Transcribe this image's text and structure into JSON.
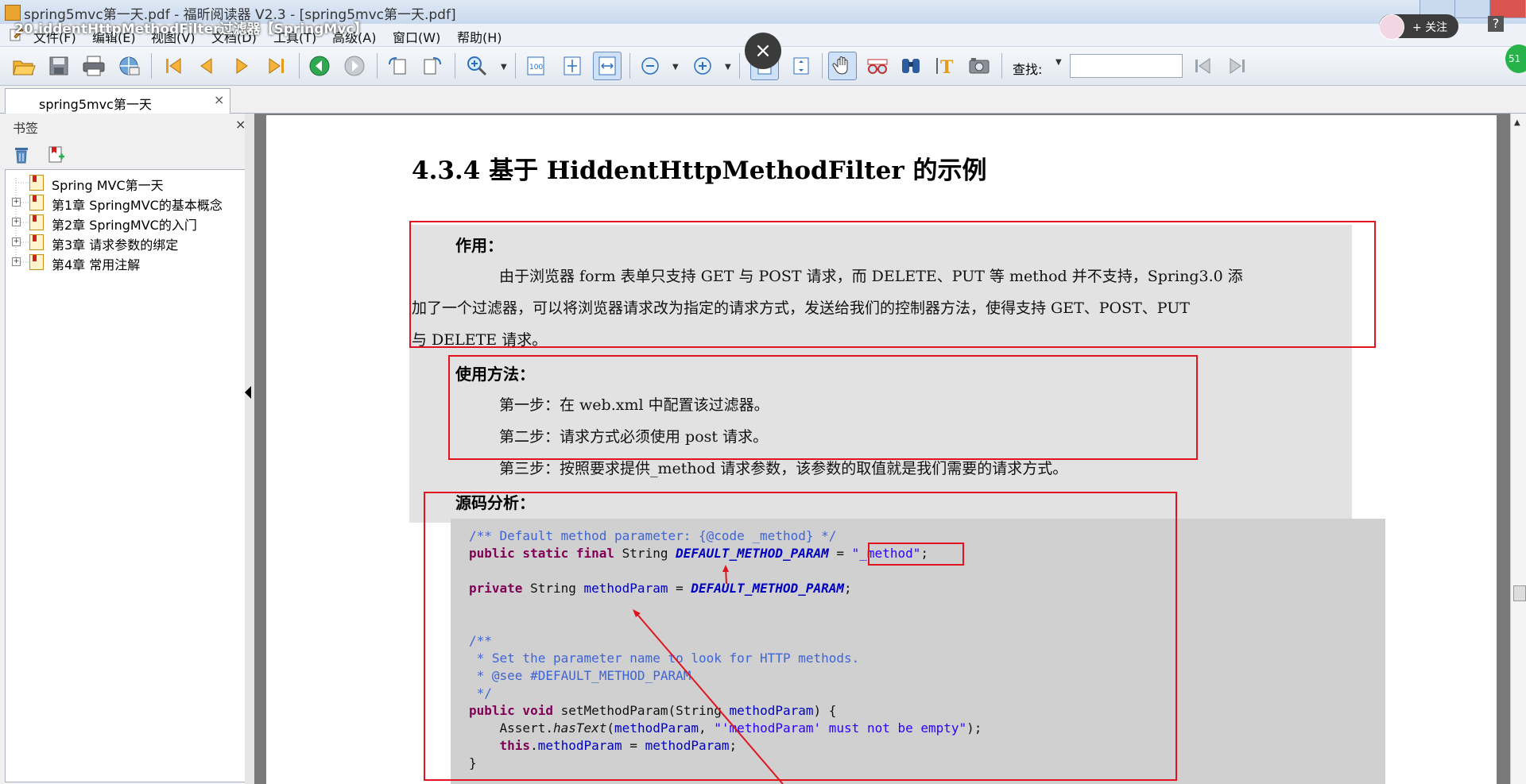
{
  "window": {
    "title": "spring5mvc第一天.pdf - 福昕阅读器 V2.3 - [spring5mvc第一天.pdf]",
    "video_title": "20.iddentHttpMethodFilter过滤器【SpringMvc】"
  },
  "menu": [
    "文件(F)",
    "编辑(E)",
    "视图(V)",
    "文档(D)",
    "工具(T)",
    "高级(A)",
    "窗口(W)",
    "帮助(H)"
  ],
  "toolbar": {
    "find_label": "查找:",
    "find_value": ""
  },
  "overlay": {
    "close_glyph": "×",
    "follow_label": "+ 关注",
    "help_glyph": "?",
    "badge": "51"
  },
  "tab": {
    "label": "spring5mvc第一天",
    "close": "×"
  },
  "bookmarks": {
    "header": "书签",
    "close": "×",
    "items": [
      {
        "label": "Spring MVC第一天",
        "expandable": false
      },
      {
        "label": "第1章 SpringMVC的基本概念",
        "expandable": true
      },
      {
        "label": "第2章 SpringMVC的入门",
        "expandable": true
      },
      {
        "label": "第3章 请求参数的绑定",
        "expandable": true
      },
      {
        "label": "第4章 常用注解",
        "expandable": true
      }
    ]
  },
  "document": {
    "heading": "4.3.4  基于 HiddentHttpMethodFilter 的示例",
    "purpose": {
      "title": "作用：",
      "lines": [
        "由于浏览器 form 表单只支持 GET 与 POST 请求，而 DELETE、PUT 等 method 并不支持，Spring3.0 添",
        "加了一个过滤器，可以将浏览器请求改为指定的请求方式，发送给我们的控制器方法，使得支持 GET、POST、PUT",
        "与 DELETE 请求。"
      ]
    },
    "usage": {
      "title": "使用方法：",
      "steps": [
        "第一步：在 web.xml 中配置该过滤器。",
        "第二步：请求方式必须使用 post 请求。",
        "第三步：按照要求提供_method 请求参数，该参数的取值就是我们需要的请求方式。"
      ]
    },
    "source": {
      "title": "源码分析：",
      "code": [
        "/** Default method parameter: {@code _method} */",
        "public static final String DEFAULT_METHOD_PARAM = \"_method\";",
        "",
        "private String methodParam = DEFAULT_METHOD_PARAM;",
        "",
        "",
        "/**",
        " * Set the parameter name to look for HTTP methods.",
        " * @see #DEFAULT_METHOD_PARAM",
        " */",
        "public void setMethodParam(String methodParam) {",
        "    Assert.hasText(methodParam, \"'methodParam' must not be empty\");",
        "    this.methodParam = methodParam;",
        "}"
      ]
    }
  }
}
